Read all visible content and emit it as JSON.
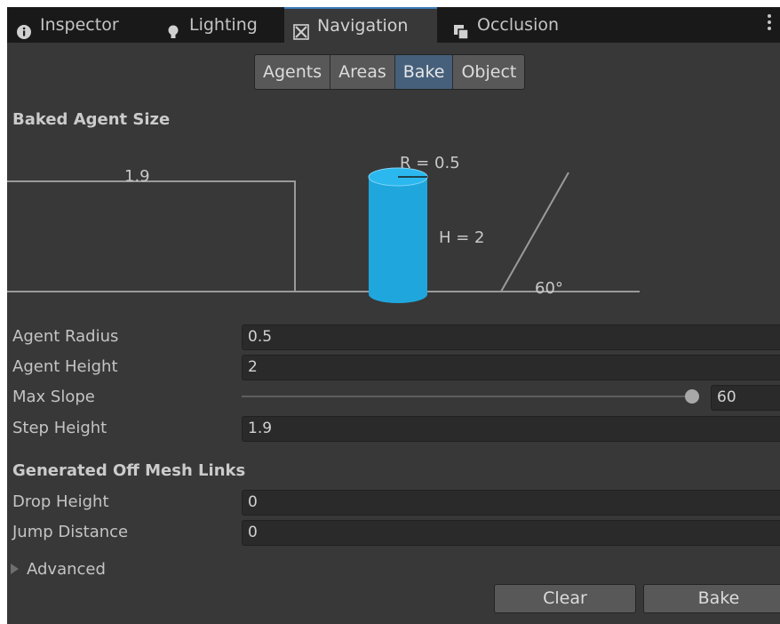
{
  "tabs": [
    {
      "label": "Inspector",
      "icon": "info-icon"
    },
    {
      "label": "Lighting",
      "icon": "lightbulb-icon"
    },
    {
      "label": "Navigation",
      "icon": "navigation-icon",
      "active": true
    },
    {
      "label": "Occlusion",
      "icon": "occlusion-icon"
    }
  ],
  "toolbar": {
    "agents": "Agents",
    "areas": "Areas",
    "bake": "Bake",
    "object": "Object",
    "selected": "Bake"
  },
  "baked_agent_size": {
    "title": "Baked Agent Size",
    "step_label": "1.9",
    "radius_label": "R = 0.5",
    "height_label": "H = 2",
    "slope_label": "60°"
  },
  "fields": {
    "agent_radius": {
      "label": "Agent Radius",
      "value": "0.5"
    },
    "agent_height": {
      "label": "Agent Height",
      "value": "2"
    },
    "max_slope": {
      "label": "Max Slope",
      "value": "60",
      "slider_fraction": 1.0
    },
    "step_height": {
      "label": "Step Height",
      "value": "1.9"
    }
  },
  "off_mesh": {
    "title": "Generated Off Mesh Links",
    "drop_height": {
      "label": "Drop Height",
      "value": "0"
    },
    "jump_distance": {
      "label": "Jump Distance",
      "value": "0"
    }
  },
  "advanced": {
    "label": "Advanced",
    "expanded": false
  },
  "buttons": {
    "clear": "Clear",
    "bake": "Bake"
  },
  "colors": {
    "background": "#383838",
    "tabbar": "#191919",
    "accent": "#3a79bb",
    "selected_segment": "#46607c",
    "agent_cylinder": "#1fa7dd"
  }
}
